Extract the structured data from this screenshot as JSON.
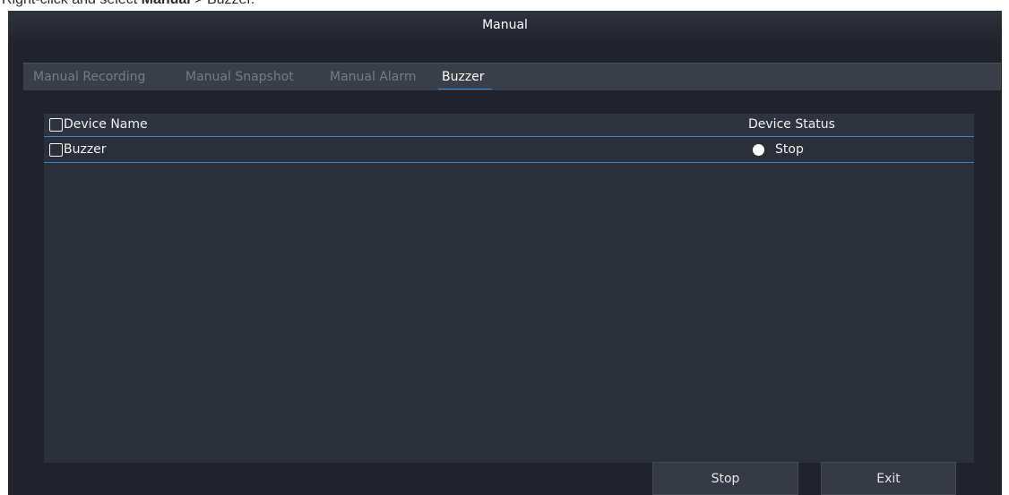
{
  "caption": {
    "prefix": "Right-click and select ",
    "bold": "Manual",
    "suffix": " > Buzzer."
  },
  "window": {
    "title": "Manual"
  },
  "tabs": [
    {
      "label": "Manual Recording",
      "active": false
    },
    {
      "label": "Manual Snapshot",
      "active": false
    },
    {
      "label": "Manual Alarm",
      "active": false
    },
    {
      "label": "Buzzer",
      "active": true
    }
  ],
  "table": {
    "columns": {
      "device_name": "Device Name",
      "device_status": "Device Status"
    },
    "rows": [
      {
        "device_name": "Buzzer",
        "status": "Stop",
        "checked": false
      }
    ]
  },
  "buttons": {
    "stop": "Stop",
    "exit": "Exit"
  },
  "colors": {
    "background": "#20232b",
    "accent": "#3a82cc",
    "status_indicator": "#ffffff"
  },
  "icons": {
    "select_all": "checkbox-icon",
    "row_select": "checkbox-icon",
    "status": "status-dot-icon"
  }
}
